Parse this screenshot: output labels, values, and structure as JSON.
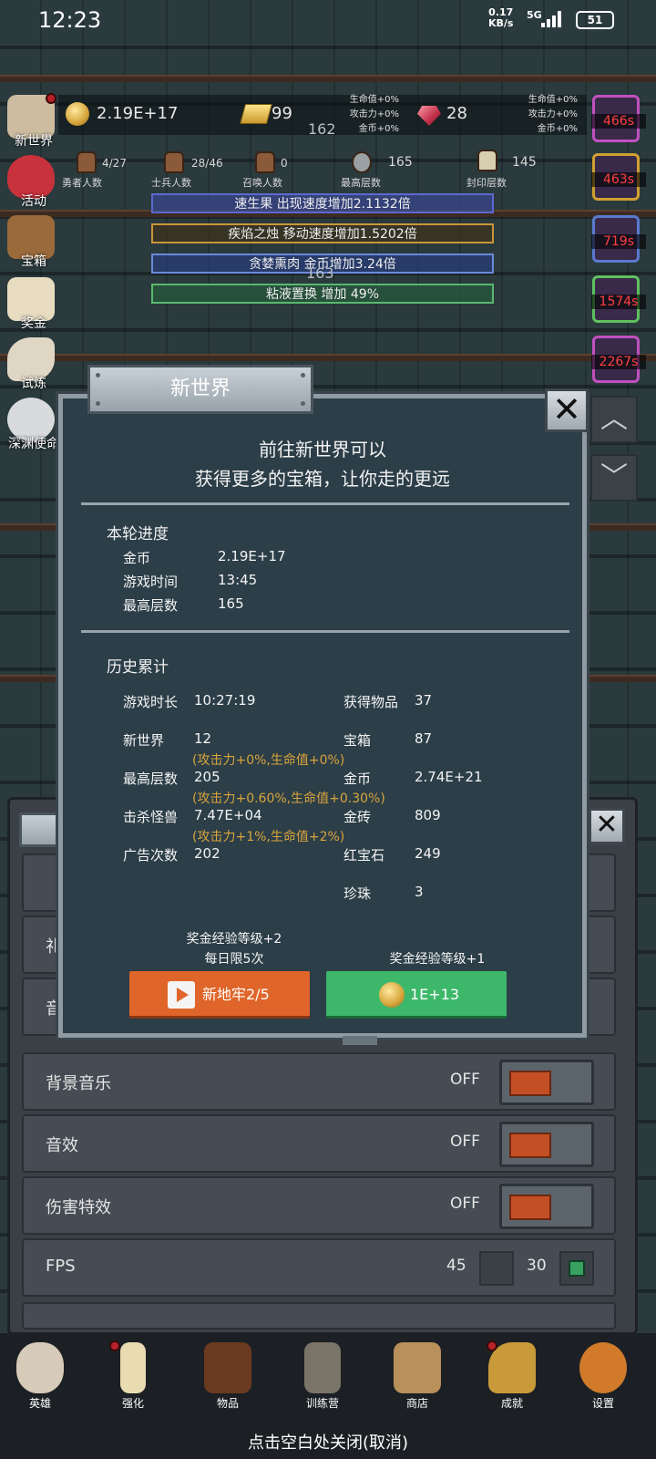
{
  "status_bar": {
    "time": "12:23",
    "net_speed_value": "0.17",
    "net_speed_unit": "KB/s",
    "signal": "5G",
    "battery": "51"
  },
  "hud": {
    "gold": "2.19E+17",
    "gold_bar": "99",
    "ruby": "28",
    "floor_mid": "162",
    "floor_lower": "163",
    "bonus_left": [
      "生命值+0%",
      "攻击力+0%",
      "金币+0%"
    ],
    "bonus_right": [
      "生命值+0%",
      "攻击力+0%",
      "金币+0%"
    ],
    "stats": [
      {
        "value": "4/27",
        "label": "勇者人数"
      },
      {
        "value": "28/46",
        "label": "士兵人数"
      },
      {
        "value": "0",
        "label": "召唤人数"
      },
      {
        "value": "165",
        "label": "最高层数"
      },
      {
        "value": "145",
        "label": "封印层数"
      }
    ],
    "buffs": [
      "速生果 出现速度增加2.1132倍",
      "疾焰之烛 移动速度增加1.5202倍",
      "贪婪熏肉 金币增加3.24倍",
      "粘液置换 增加 49%"
    ]
  },
  "left_menu": [
    {
      "label": "新世界",
      "icon": "ruins-icon"
    },
    {
      "label": "活动",
      "icon": "heart-icon"
    },
    {
      "label": "宝箱",
      "icon": "chest-icon"
    },
    {
      "label": "奖金",
      "icon": "letter-icon"
    },
    {
      "label": "试炼",
      "icon": "feather-icon"
    },
    {
      "label": "深渊使命",
      "icon": "orb-icon"
    }
  ],
  "right_timers": [
    "466s",
    "463s",
    "719s",
    "1574s",
    "2267s"
  ],
  "colors": {
    "accent_orange": "#e0652a",
    "accent_green": "#3db86a",
    "highlight_text": "#d9a43c",
    "timer_red": "#ff4040",
    "panel": "#2c3e48"
  },
  "modal": {
    "title": "新世界",
    "close": "✕",
    "headline": [
      "前往新世界可以",
      "获得更多的宝箱，让你走的更远"
    ],
    "round": {
      "title": "本轮进度",
      "rows": [
        {
          "k": "金币",
          "v": "2.19E+17"
        },
        {
          "k": "游戏时间",
          "v": "13:45"
        },
        {
          "k": "最高层数",
          "v": "165"
        }
      ]
    },
    "history": {
      "title": "历史累计",
      "left": [
        {
          "k": "游戏时长",
          "v": "10:27:19"
        },
        {
          "k": "新世界",
          "v": "12",
          "note": "(攻击力+0%,生命值+0%)"
        },
        {
          "k": "最高层数",
          "v": "205",
          "note": "(攻击力+0.60%,生命值+0.30%)"
        },
        {
          "k": "击杀怪兽",
          "v": "7.47E+04",
          "note": "(攻击力+1%,生命值+2%)"
        },
        {
          "k": "广告次数",
          "v": "202"
        }
      ],
      "right": [
        {
          "k": "获得物品",
          "v": "37"
        },
        {
          "k": "宝箱",
          "v": "87"
        },
        {
          "k": "金币",
          "v": "2.74E+21"
        },
        {
          "k": "金砖",
          "v": "809"
        },
        {
          "k": "红宝石",
          "v": "249"
        },
        {
          "k": "珍珠",
          "v": "3"
        }
      ]
    },
    "left_btn": {
      "note1": "奖金经验等级+2",
      "note2": "每日限5次",
      "label": "新地牢2/5"
    },
    "right_btn": {
      "note1": "奖金经验等级+1",
      "label": "1E+13"
    }
  },
  "settings": {
    "close": "✕",
    "partial_rows": [
      "礼",
      "音"
    ],
    "rows": [
      {
        "label": "背景音乐",
        "state": "OFF"
      },
      {
        "label": "音效",
        "state": "OFF"
      },
      {
        "label": "伤害特效",
        "state": "OFF"
      }
    ],
    "fps": {
      "label": "FPS",
      "opt1": "45",
      "opt2": "30",
      "selected": "30"
    }
  },
  "scroll": {
    "up": "︿",
    "down": "﹀"
  },
  "bottom_nav": [
    {
      "label": "英雄",
      "icon": "skull-icon"
    },
    {
      "label": "强化",
      "icon": "candle-icon"
    },
    {
      "label": "物品",
      "icon": "book-icon"
    },
    {
      "label": "训练营",
      "icon": "lantern-icon"
    },
    {
      "label": "商店",
      "icon": "mug-icon"
    },
    {
      "label": "成就",
      "icon": "key-icon"
    },
    {
      "label": "设置",
      "icon": "gear-icon"
    }
  ],
  "hint": "点击空白处关闭(取消)"
}
